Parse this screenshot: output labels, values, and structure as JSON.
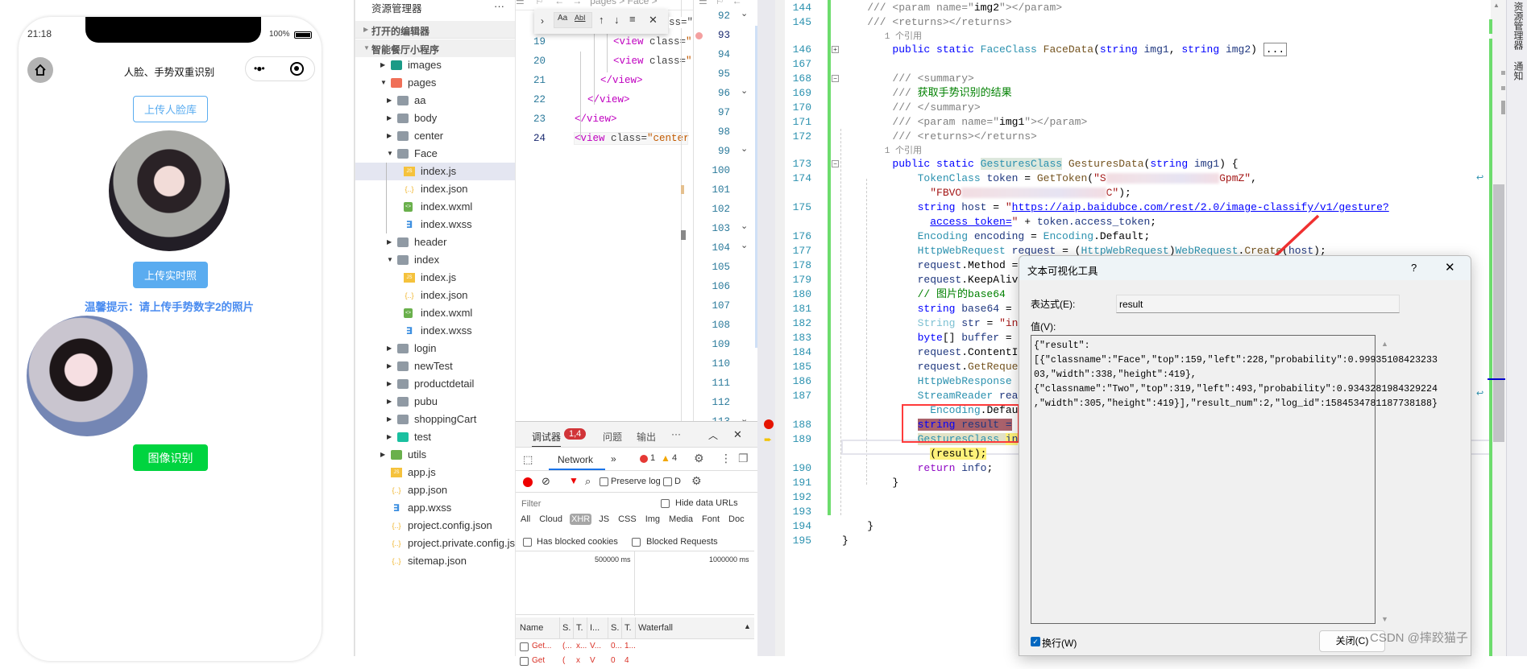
{
  "colors": {
    "accent_blue": "#5aacf0",
    "hint_blue": "#4a8cf0",
    "green_button": "#00d43f",
    "breakpoint": "#e51400",
    "highlight_box": "#ff3b3b",
    "change_bar": "#6ddc6d"
  },
  "simulator": {
    "status_time": "21:18",
    "battery": "100%",
    "nav_title": "人脸、手势双重识别",
    "home_icon": "home-icon",
    "capsule_more": "•●•",
    "upload_face_lib": "上传人脸库",
    "upload_photo": "上传实时照",
    "hint": "温馨提示：请上传手势数字2的照片",
    "recognize": "图像识别"
  },
  "explorer": {
    "title": "资源管理器",
    "more": "···",
    "open_editors": "打开的编辑器",
    "project": "智能餐厅小程序",
    "tree": [
      {
        "label": "images",
        "depth": 0,
        "kind": "folder-img",
        "open": false
      },
      {
        "label": "pages",
        "depth": 0,
        "kind": "folder-pages",
        "open": true
      },
      {
        "label": "aa",
        "depth": 1,
        "kind": "folder",
        "open": false
      },
      {
        "label": "body",
        "depth": 1,
        "kind": "folder",
        "open": false
      },
      {
        "label": "center",
        "depth": 1,
        "kind": "folder",
        "open": false
      },
      {
        "label": "Face",
        "depth": 1,
        "kind": "folder",
        "open": true
      },
      {
        "label": "index.js",
        "depth": 2,
        "kind": "js",
        "selected": true
      },
      {
        "label": "index.json",
        "depth": 2,
        "kind": "json"
      },
      {
        "label": "index.wxml",
        "depth": 2,
        "kind": "wxml"
      },
      {
        "label": "index.wxss",
        "depth": 2,
        "kind": "wxss"
      },
      {
        "label": "header",
        "depth": 1,
        "kind": "folder",
        "open": false
      },
      {
        "label": "index",
        "depth": 1,
        "kind": "folder",
        "open": true
      },
      {
        "label": "index.js",
        "depth": 2,
        "kind": "js"
      },
      {
        "label": "index.json",
        "depth": 2,
        "kind": "json"
      },
      {
        "label": "index.wxml",
        "depth": 2,
        "kind": "wxml"
      },
      {
        "label": "index.wxss",
        "depth": 2,
        "kind": "wxss"
      },
      {
        "label": "login",
        "depth": 1,
        "kind": "folder",
        "open": false
      },
      {
        "label": "newTest",
        "depth": 1,
        "kind": "folder",
        "open": false
      },
      {
        "label": "productdetail",
        "depth": 1,
        "kind": "folder",
        "open": false
      },
      {
        "label": "pubu",
        "depth": 1,
        "kind": "folder",
        "open": false
      },
      {
        "label": "shoppingCart",
        "depth": 1,
        "kind": "folder",
        "open": false
      },
      {
        "label": "test",
        "depth": 1,
        "kind": "folder-test",
        "open": false
      },
      {
        "label": "utils",
        "depth": 0,
        "kind": "folder-utils",
        "open": false
      },
      {
        "label": "app.js",
        "depth": 0,
        "kind": "js"
      },
      {
        "label": "app.json",
        "depth": 0,
        "kind": "json"
      },
      {
        "label": "app.wxss",
        "depth": 0,
        "kind": "wxss"
      },
      {
        "label": "project.config.json",
        "depth": 0,
        "kind": "json"
      },
      {
        "label": "project.private.config.js...",
        "depth": 0,
        "kind": "json"
      },
      {
        "label": "sitemap.json",
        "depth": 0,
        "kind": "json"
      }
    ]
  },
  "editor1": {
    "breadcrumb": "pages > Face >",
    "find_widget": {
      "match_case": "Aa",
      "whole_word": "AbI"
    },
    "lines": [
      {
        "n": "19",
        "indent": 6,
        "tokens": [
          [
            "tg",
            "<view "
          ],
          [
            "at",
            "class="
          ],
          [
            "sv",
            "\""
          ]
        ]
      },
      {
        "n": "20",
        "indent": 6,
        "tokens": [
          [
            "tg",
            "<view "
          ],
          [
            "at",
            "class="
          ],
          [
            "sv",
            "\""
          ]
        ]
      },
      {
        "n": "21",
        "indent": 4,
        "tokens": [
          [
            "tg",
            "</view>"
          ]
        ]
      },
      {
        "n": "22",
        "indent": 2,
        "tokens": [
          [
            "tg",
            "</view>"
          ]
        ]
      },
      {
        "n": "23",
        "indent": 0,
        "tokens": [
          [
            "tg",
            "</view>"
          ]
        ]
      },
      {
        "n": "24",
        "indent": 0,
        "tokens": [
          [
            "tg",
            "<view "
          ],
          [
            "at",
            "class="
          ],
          [
            "sv",
            "\"center"
          ]
        ]
      }
    ],
    "hidden_line_tail": "ss=\""
  },
  "editor2": {
    "lines": [
      "92",
      "93",
      "94",
      "95",
      "96",
      "97",
      "98",
      "99",
      "100",
      "101",
      "102",
      "103",
      "104",
      "105",
      "106",
      "107",
      "108",
      "109",
      "110",
      "111",
      "112",
      "113"
    ],
    "folds": [
      "92",
      "96",
      "99",
      "103",
      "104",
      "113"
    ],
    "breakpoint_line": "93"
  },
  "devtools": {
    "tabs": [
      "调试器",
      "问题",
      "输出"
    ],
    "badge": "1,4",
    "more": "···",
    "network_tab": "Network",
    "overflow": "»",
    "errors": "1",
    "warnings": "4",
    "preserve_log": "Preserve log",
    "disable_cache": "D",
    "filter_placeholder": "Filter",
    "hide_data_urls": "Hide data URLs",
    "types": [
      "All",
      "Cloud",
      "XHR",
      "JS",
      "CSS",
      "Img",
      "Media",
      "Font",
      "Doc"
    ],
    "active_type": "XHR",
    "has_blocked_cookies": "Has blocked cookies",
    "blocked_requests": "Blocked Requests",
    "timeline_ticks": [
      "500000 ms",
      "1000000 ms"
    ],
    "columns": [
      "Name",
      "S.",
      "T.",
      "I...",
      "S.",
      "T.",
      "Waterfall"
    ],
    "rows": [
      [
        "Get...",
        "(...",
        "x...",
        "V...",
        "0...",
        "1..."
      ],
      [
        "Get",
        "(",
        "x",
        "V",
        "0",
        "4"
      ]
    ]
  },
  "vs": {
    "lines": [
      {
        "n": "144",
        "t": [
          [
            "cm",
            "    /// <param name=\""
          ],
          [
            "pl",
            "img2"
          ],
          [
            "cm",
            "\"></param>"
          ]
        ]
      },
      {
        "n": "145",
        "t": [
          [
            "cm",
            "    /// <returns></returns>"
          ]
        ]
      },
      {
        "ref": "        1 个引用"
      },
      {
        "n": "146",
        "fold": "+",
        "t": [
          [
            "kw",
            "        public static "
          ],
          [
            "ty",
            "FaceClass "
          ],
          [
            "fn",
            "FaceData"
          ],
          [
            "pl",
            "("
          ],
          [
            "kw",
            "string "
          ],
          [
            "id",
            "img1"
          ],
          [
            "pl",
            ", "
          ],
          [
            "kw",
            "string "
          ],
          [
            "id",
            "img2"
          ],
          [
            "pl",
            ") "
          ],
          [
            "box",
            "..."
          ]
        ]
      },
      {
        "n": "167",
        "t": []
      },
      {
        "n": "168",
        "fold": "-",
        "t": [
          [
            "cm",
            "        /// <summary>"
          ]
        ]
      },
      {
        "n": "169",
        "t": [
          [
            "cm",
            "        /// "
          ],
          [
            "cmg",
            "获取手势识别的结果"
          ]
        ]
      },
      {
        "n": "170",
        "t": [
          [
            "cm",
            "        /// </summary>"
          ]
        ]
      },
      {
        "n": "171",
        "t": [
          [
            "cm",
            "        /// <param name=\""
          ],
          [
            "pl",
            "img1"
          ],
          [
            "cm",
            "\"></param>"
          ]
        ]
      },
      {
        "n": "172",
        "t": [
          [
            "cm",
            "        /// <returns></returns>"
          ]
        ]
      },
      {
        "ref": "        1 个引用"
      },
      {
        "n": "173",
        "fold": "-",
        "t": [
          [
            "kw",
            "        public static "
          ],
          [
            "ty tyhl",
            "GesturesClass"
          ],
          [
            "pl",
            " "
          ],
          [
            "fn",
            "GesturesData"
          ],
          [
            "pl",
            "("
          ],
          [
            "kw",
            "string "
          ],
          [
            "id",
            "img1"
          ],
          [
            "pl",
            ") {"
          ]
        ]
      },
      {
        "n": "174",
        "t": [
          [
            "ty",
            "            TokenClass "
          ],
          [
            "id",
            "token "
          ],
          [
            "pl",
            "= "
          ],
          [
            "fn",
            "GetToken"
          ],
          [
            "pl",
            "("
          ],
          [
            "st",
            "\"S"
          ],
          [
            "blur",
            "                  "
          ],
          [
            "st",
            "GpmZ\""
          ],
          [
            "pl",
            ","
          ]
        ]
      },
      {
        "t": [
          [
            "st",
            "              \"FBVO"
          ],
          [
            "blur",
            "                       "
          ],
          [
            "st",
            "C\""
          ],
          [
            "pl",
            ");"
          ]
        ]
      },
      {
        "n": "175",
        "t": [
          [
            "kw",
            "            string "
          ],
          [
            "id",
            "host "
          ],
          [
            "pl",
            "= "
          ],
          [
            "st",
            "\""
          ],
          [
            "url",
            "https://aip.baidubce.com/rest/2.0/image-classify/v1/gesture?"
          ]
        ]
      },
      {
        "t": [
          [
            "pl",
            "              "
          ],
          [
            "url",
            "access_token="
          ],
          [
            "st",
            "\""
          ],
          [
            "pl",
            " + "
          ],
          [
            "id",
            "token.access_token"
          ],
          [
            "pl",
            ";"
          ]
        ]
      },
      {
        "n": "176",
        "t": [
          [
            "ty",
            "            Encoding "
          ],
          [
            "id",
            "encoding "
          ],
          [
            "pl",
            "= "
          ],
          [
            "ty",
            "Encoding"
          ],
          [
            "pl",
            ".Default;"
          ]
        ]
      },
      {
        "n": "177",
        "t": [
          [
            "ty",
            "            HttpWebRequest "
          ],
          [
            "id",
            "request "
          ],
          [
            "pl",
            "= ("
          ],
          [
            "ty",
            "HttpWebRequest"
          ],
          [
            "pl",
            ")"
          ],
          [
            "ty",
            "WebRequest"
          ],
          [
            "pl",
            "."
          ],
          [
            "fn",
            "Create"
          ],
          [
            "pl",
            "("
          ],
          [
            "id",
            "host"
          ],
          [
            "pl",
            ");"
          ]
        ]
      },
      {
        "n": "178",
        "t": [
          [
            "id",
            "            request"
          ],
          [
            "pl",
            ".Method ="
          ]
        ]
      },
      {
        "n": "179",
        "t": [
          [
            "id",
            "            request"
          ],
          [
            "pl",
            ".KeepAliv"
          ]
        ]
      },
      {
        "n": "180",
        "t": [
          [
            "cmg",
            "            // 图片的base64"
          ]
        ]
      },
      {
        "n": "181",
        "t": [
          [
            "kw",
            "            string "
          ],
          [
            "id",
            "base64 "
          ],
          [
            "pl",
            "="
          ]
        ]
      },
      {
        "n": "182",
        "t": [
          [
            "tyl",
            "            String "
          ],
          [
            "id",
            "str "
          ],
          [
            "pl",
            "= "
          ],
          [
            "st",
            "\"in"
          ]
        ]
      },
      {
        "n": "183",
        "t": [
          [
            "kw",
            "            byte"
          ],
          [
            "pl",
            "[] "
          ],
          [
            "id",
            "buffer "
          ],
          [
            "pl",
            "="
          ]
        ]
      },
      {
        "n": "184",
        "t": [
          [
            "id",
            "            request"
          ],
          [
            "pl",
            ".ContentI"
          ]
        ]
      },
      {
        "n": "185",
        "t": [
          [
            "id",
            "            request"
          ],
          [
            "pl",
            "."
          ],
          [
            "fn",
            "GetReque"
          ]
        ]
      },
      {
        "n": "186",
        "t": [
          [
            "ty",
            "            HttpWebResponse"
          ]
        ]
      },
      {
        "n": "187",
        "t": [
          [
            "ty",
            "            StreamReader "
          ],
          [
            "id",
            "rea"
          ]
        ]
      },
      {
        "t": [
          [
            "pl",
            "              "
          ],
          [
            "ty",
            "Encoding"
          ],
          [
            "pl",
            ".Defau"
          ]
        ]
      },
      {
        "n": "188",
        "bp": true,
        "t": [
          [
            "pl",
            "            "
          ],
          [
            "kw hlr",
            "string "
          ],
          [
            "id hlr",
            "result ="
          ]
        ]
      },
      {
        "n": "189",
        "cur": true,
        "t": [
          [
            "pl",
            "            "
          ],
          [
            "ty hlt",
            "GesturesClass "
          ],
          [
            "id hly",
            "in"
          ]
        ]
      },
      {
        "t": [
          [
            "pl",
            "              "
          ],
          [
            "pl hly",
            "(result);"
          ]
        ]
      },
      {
        "n": "190",
        "t": [
          [
            "kwp",
            "            return "
          ],
          [
            "id",
            "info"
          ],
          [
            "pl",
            ";"
          ]
        ]
      },
      {
        "n": "191",
        "t": [
          [
            "pl",
            "        }"
          ]
        ]
      },
      {
        "n": "192",
        "t": []
      },
      {
        "n": "193",
        "t": []
      },
      {
        "n": "194",
        "t": [
          [
            "pl",
            "    }"
          ]
        ]
      },
      {
        "n": "195",
        "t": [
          [
            "pl",
            "}"
          ]
        ]
      }
    ],
    "side_tabs": [
      "资源管理器",
      "通知"
    ]
  },
  "dialog": {
    "title": "文本可视化工具",
    "help": "?",
    "expr_label": "表达式(E):",
    "expr_value": "result",
    "value_label": "值(V):",
    "value_lines": [
      "{\"result\":",
      "[{\"classname\":\"Face\",\"top\":159,\"left\":228,\"probability\":0.99935108423233",
      "03,\"width\":338,\"height\":419},",
      "{\"classname\":\"Two\",\"top\":319,\"left\":493,\"probability\":0.9343281984329224",
      ",\"width\":305,\"height\":419}],\"result_num\":2,\"log_id\":1584534781187738188}"
    ],
    "wrap_label": "换行(W)",
    "wrap_checked": true,
    "close_label": "关闭(C)"
  },
  "watermark": "CSDN @摔跤猫子"
}
